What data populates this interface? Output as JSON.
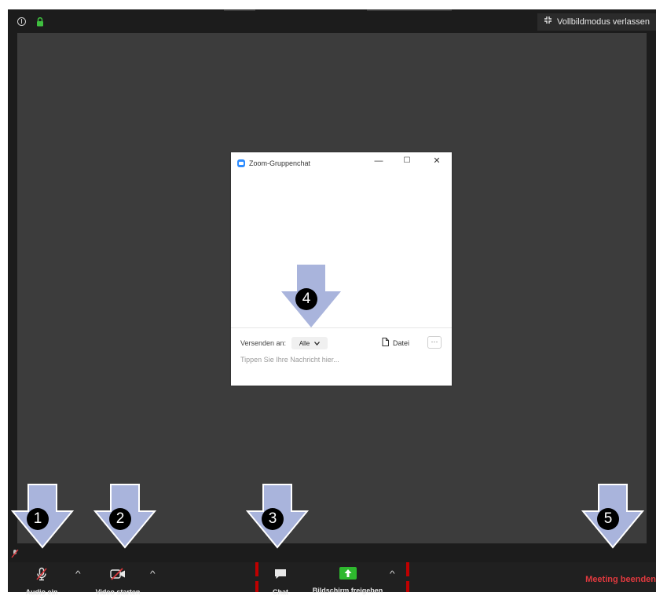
{
  "topbar": {
    "exit_fullscreen_label": "Vollbildmodus verlassen"
  },
  "chat": {
    "title": "Zoom-Gruppenchat",
    "minimize": "—",
    "maximize": "☐",
    "close": "✕",
    "send_to_label": "Versenden an:",
    "recipient": "Alle",
    "file_label": "Datei",
    "more_label": "···",
    "message_placeholder": "Tippen Sie Ihre Nachricht hier..."
  },
  "toolbar": {
    "audio_label": "Audio ein",
    "video_label": "Video starten",
    "chat_label": "Chat",
    "share_label": "Bildschirm freigeben",
    "end_label": "Meeting beenden"
  },
  "callouts": [
    "1",
    "2",
    "3",
    "4",
    "5"
  ],
  "colors": {
    "accent_blue": "#2d8cff",
    "share_green": "#2eb82e",
    "end_red": "#e0393e",
    "callout_fill": "#a9b4dc"
  }
}
